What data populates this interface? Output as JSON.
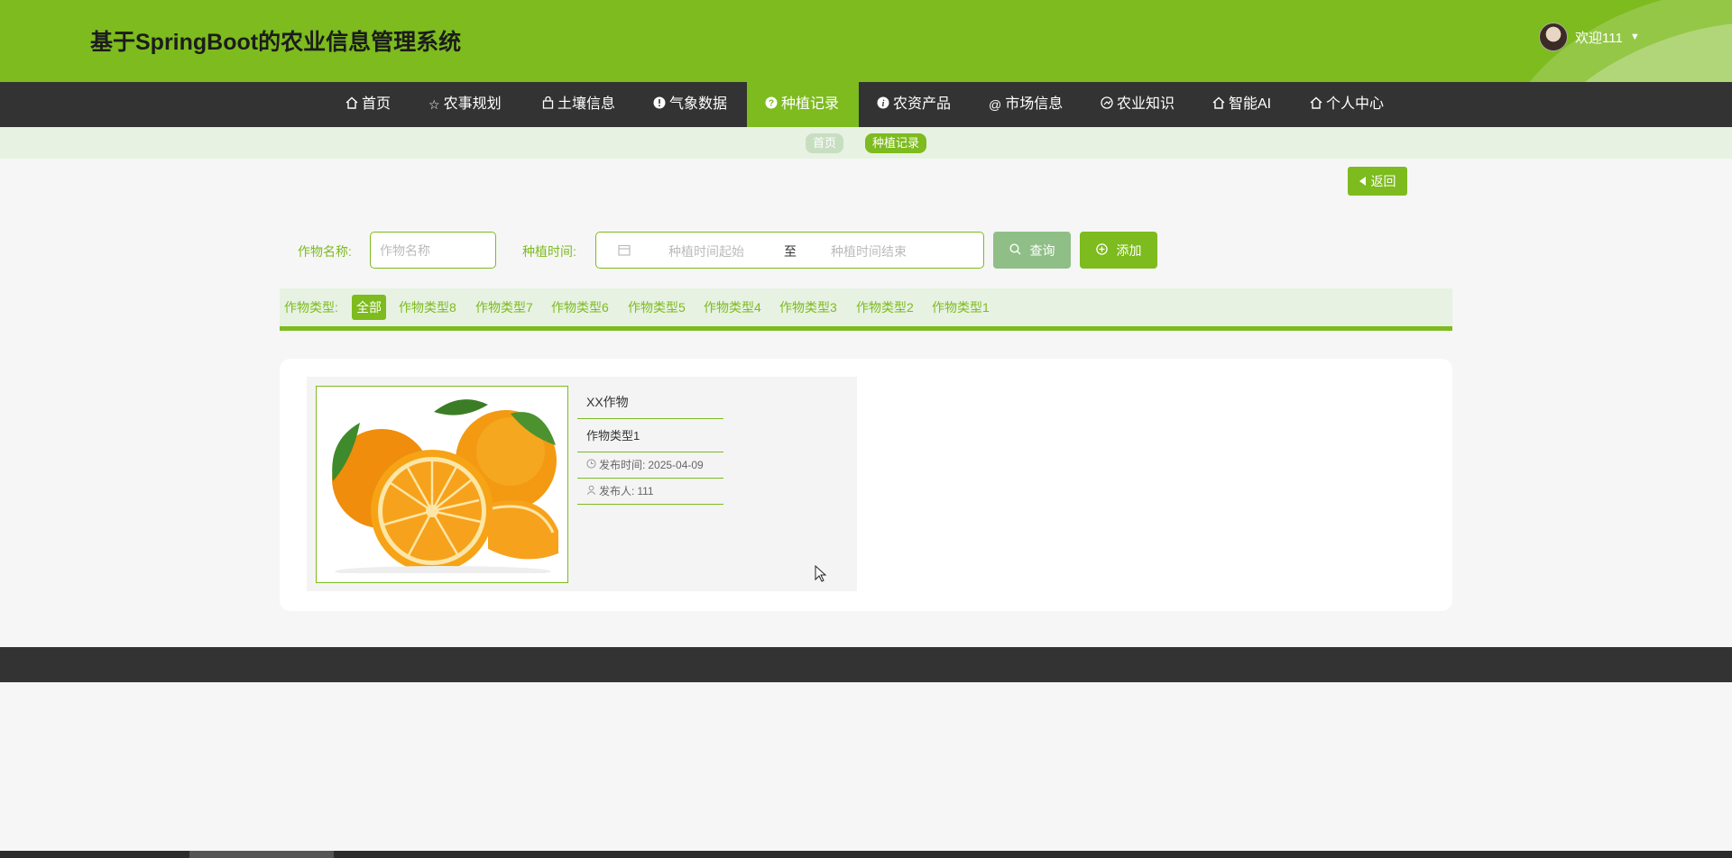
{
  "header": {
    "title": "基于SpringBoot的农业信息管理系统",
    "user_greeting": "欢迎111"
  },
  "nav": {
    "items": [
      {
        "label": "首页",
        "icon": "home-icon"
      },
      {
        "label": "农事规划",
        "icon": "star-icon"
      },
      {
        "label": "土壤信息",
        "icon": "bag-icon"
      },
      {
        "label": "气象数据",
        "icon": "alert-icon"
      },
      {
        "label": "种植记录",
        "icon": "help-icon",
        "active": true
      },
      {
        "label": "农资产品",
        "icon": "info-icon"
      },
      {
        "label": "市场信息",
        "icon": "at-icon"
      },
      {
        "label": "农业知识",
        "icon": "gauge-icon"
      },
      {
        "label": "智能AI",
        "icon": "home-icon"
      },
      {
        "label": "个人中心",
        "icon": "home-icon"
      }
    ]
  },
  "breadcrumb": {
    "home": "首页",
    "current": "种植记录"
  },
  "back_label": "返回",
  "search": {
    "name_label": "作物名称:",
    "name_placeholder": "作物名称",
    "time_label": "种植时间:",
    "start_placeholder": "种植时间起始",
    "separator": "至",
    "end_placeholder": "种植时间结束",
    "query_label": "查询",
    "add_label": "添加"
  },
  "type_filter": {
    "label": "作物类型:",
    "options": [
      "全部",
      "作物类型8",
      "作物类型7",
      "作物类型6",
      "作物类型5",
      "作物类型4",
      "作物类型3",
      "作物类型2",
      "作物类型1"
    ],
    "selected": "全部"
  },
  "records": [
    {
      "name": "XX作物",
      "type": "作物类型1",
      "publish_time_label": "发布时间:",
      "publish_time": "2025-04-09",
      "publisher_label": "发布人:",
      "publisher": "111"
    }
  ],
  "colors": {
    "primary": "#7dbb1e",
    "dark": "#333333",
    "light_green": "#e7f2e2"
  }
}
